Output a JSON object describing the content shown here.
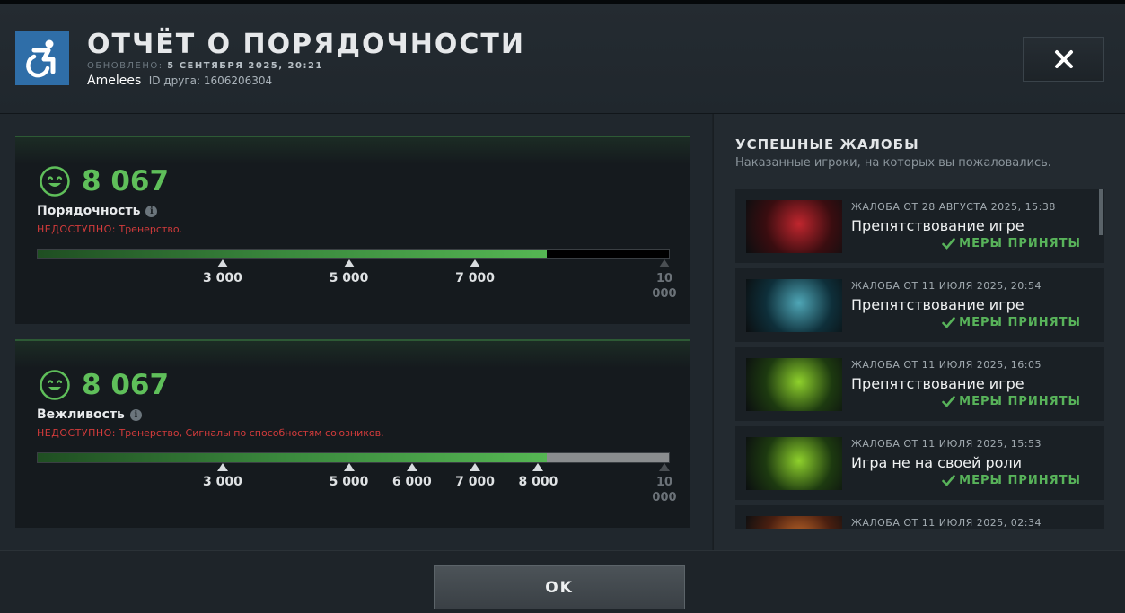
{
  "header": {
    "title": "ОТЧЁТ О ПОРЯДОЧНОСТИ",
    "updated_label": "ОБНОВЛЕНО:",
    "updated_value": "5 СЕНТЯБРЯ 2025, 20:21",
    "player_name": "Amelees",
    "friend_id": "ID друга: 1606206304",
    "close_icon": "close-icon",
    "logo_icon": "wheelchair-icon"
  },
  "cards": [
    {
      "score": "8 067",
      "metric": "Порядочность",
      "unavail_label": "НЕДОСТУПНО:",
      "unavail_text": "Тренерство.",
      "fill_value": 8067,
      "max_value": 10000,
      "rest_color": "#000000",
      "ticks": [
        {
          "value": 3000,
          "label": "3 000",
          "active": true
        },
        {
          "value": 5000,
          "label": "5 000",
          "active": true
        },
        {
          "value": 7000,
          "label": "7 000",
          "active": true
        },
        {
          "value": 10000,
          "label": "10 000",
          "active": false
        }
      ]
    },
    {
      "score": "8 067",
      "metric": "Вежливость",
      "unavail_label": "НЕДОСТУПНО:",
      "unavail_text": "Тренерство, Сигналы по способностям союзников.",
      "fill_value": 8067,
      "max_value": 10000,
      "rest_color": "#8a8d8f",
      "ticks": [
        {
          "value": 3000,
          "label": "3 000",
          "active": true
        },
        {
          "value": 5000,
          "label": "5 000",
          "active": true
        },
        {
          "value": 6000,
          "label": "6 000",
          "active": true
        },
        {
          "value": 7000,
          "label": "7 000",
          "active": true
        },
        {
          "value": 8000,
          "label": "8 000",
          "active": true
        },
        {
          "value": 10000,
          "label": "10 000",
          "active": false
        }
      ]
    }
  ],
  "reports_panel": {
    "title": "УСПЕШНЫЕ ЖАЛОБЫ",
    "subtitle": "Наказанные игроки, на которых вы пожаловались.",
    "items": [
      {
        "date": "ЖАЛОБА ОТ 28 АВГУСТА 2025, 15:38",
        "reason": "Препятствование игре",
        "status": "МЕРЫ ПРИНЯТЫ",
        "hero_colors": [
          "#3a0d10",
          "#c0262e"
        ]
      },
      {
        "date": "ЖАЛОБА ОТ 11 ИЮЛЯ 2025, 20:54",
        "reason": "Препятствование игре",
        "status": "МЕРЫ ПРИНЯТЫ",
        "hero_colors": [
          "#0e2f3a",
          "#4fa6b6"
        ]
      },
      {
        "date": "ЖАЛОБА ОТ 11 ИЮЛЯ 2025, 16:05",
        "reason": "Препятствование игре",
        "status": "МЕРЫ ПРИНЯТЫ",
        "hero_colors": [
          "#1d3a10",
          "#8fd12c"
        ]
      },
      {
        "date": "ЖАЛОБА ОТ 11 ИЮЛЯ 2025, 15:53",
        "reason": "Игра не на своей роли",
        "status": "МЕРЫ ПРИНЯТЫ",
        "hero_colors": [
          "#1d3a10",
          "#8fd12c"
        ]
      },
      {
        "date": "ЖАЛОБА ОТ 11 ИЮЛЯ 2025, 02:34",
        "reason": "",
        "status": "",
        "hero_colors": [
          "#4a1f10",
          "#c46a2a"
        ]
      }
    ]
  },
  "footer": {
    "ok_label": "OK"
  }
}
